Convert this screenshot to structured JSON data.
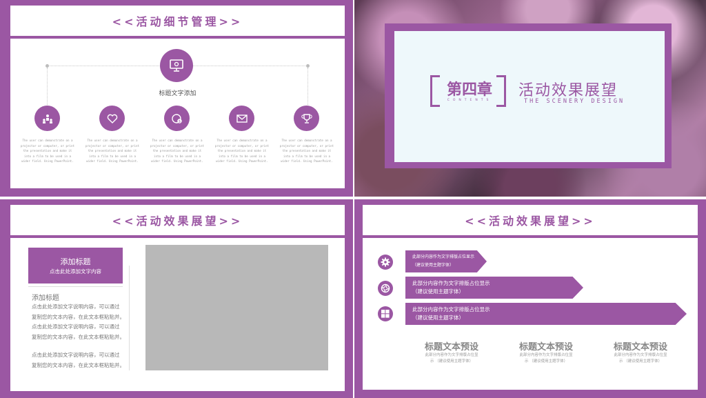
{
  "colors": {
    "accent": "#9b57a3",
    "panel": "#ffffff",
    "slide2_inner": "#eef8fb"
  },
  "slide1": {
    "title": "<<活动细节管理>>",
    "center_label": "标题文字添加",
    "items": [
      {
        "icon": "people-icon",
        "text": "The user can demonstrate on a projector or computer, or print the presentation and make it into a film to be used in a wider field. Using PowerPoint."
      },
      {
        "icon": "heart-icon",
        "text": "The user can demonstrate on a projector or computer, or print the presentation and make it into a film to be used in a wider field. Using PowerPoint."
      },
      {
        "icon": "money-clock-icon",
        "text": "The user can demonstrate on a projector or computer, or print the presentation and make it into a film to be used in a wider field. Using PowerPoint."
      },
      {
        "icon": "mail-icon",
        "text": "The user can demonstrate on a projector or computer, or print the presentation and make it into a film to be used in a wider field. Using PowerPoint."
      },
      {
        "icon": "trophy-icon",
        "text": "The user can demonstrate on a projector or computer, or print the presentation and make it into a film to be used in a wider field. Using PowerPoint."
      }
    ]
  },
  "slide2": {
    "chapter": "第四章",
    "contents": "CONTENTS",
    "title": "活动效果展望",
    "subtitle": "THE SCENERY DESIGN"
  },
  "slide3": {
    "title": "<<活动效果展望>>",
    "box_title": "添加标题",
    "box_sub": "点击此处添加文字内容",
    "section_title": "添加标题",
    "paragraph1": [
      "点击此处添加文字说明内容，可以通过",
      "复制您的文本内容，在此文本框粘贴并。",
      "点击此处添加文字说明内容，可以通过",
      "复制您的文本内容，在此文本框粘贴并。"
    ],
    "paragraph2": [
      "点击此处添加文字说明内容，可以通过",
      "复制您的文本内容，在此文本框粘贴并。"
    ]
  },
  "slide4": {
    "title": "<<活动效果展望>>",
    "arrows": [
      {
        "icon": "gear-icon",
        "line1": "此部分内容作为文字排版占位显示",
        "line2": "（建议使用主题字体）"
      },
      {
        "icon": "aperture-icon",
        "line1": "此部分内容作为文字排版占位显示",
        "line2": "（建议使用主题字体）"
      },
      {
        "icon": "windows-icon",
        "line1": "此部分内容作为文字排版占位显示",
        "line2": "（建议使用主题字体）"
      }
    ],
    "columns": [
      {
        "title": "标题文本预设",
        "sub1": "此部分内容作为文字排版占位显",
        "sub2": "示 （建议使用主题字体）"
      },
      {
        "title": "标题文本预设",
        "sub1": "此部分内容作为文字排版占位显",
        "sub2": "示 （建议使用主题字体）"
      },
      {
        "title": "标题文本预设",
        "sub1": "此部分内容作为文字排版占位显",
        "sub2": "示 （建议使用主题字体）"
      }
    ]
  }
}
